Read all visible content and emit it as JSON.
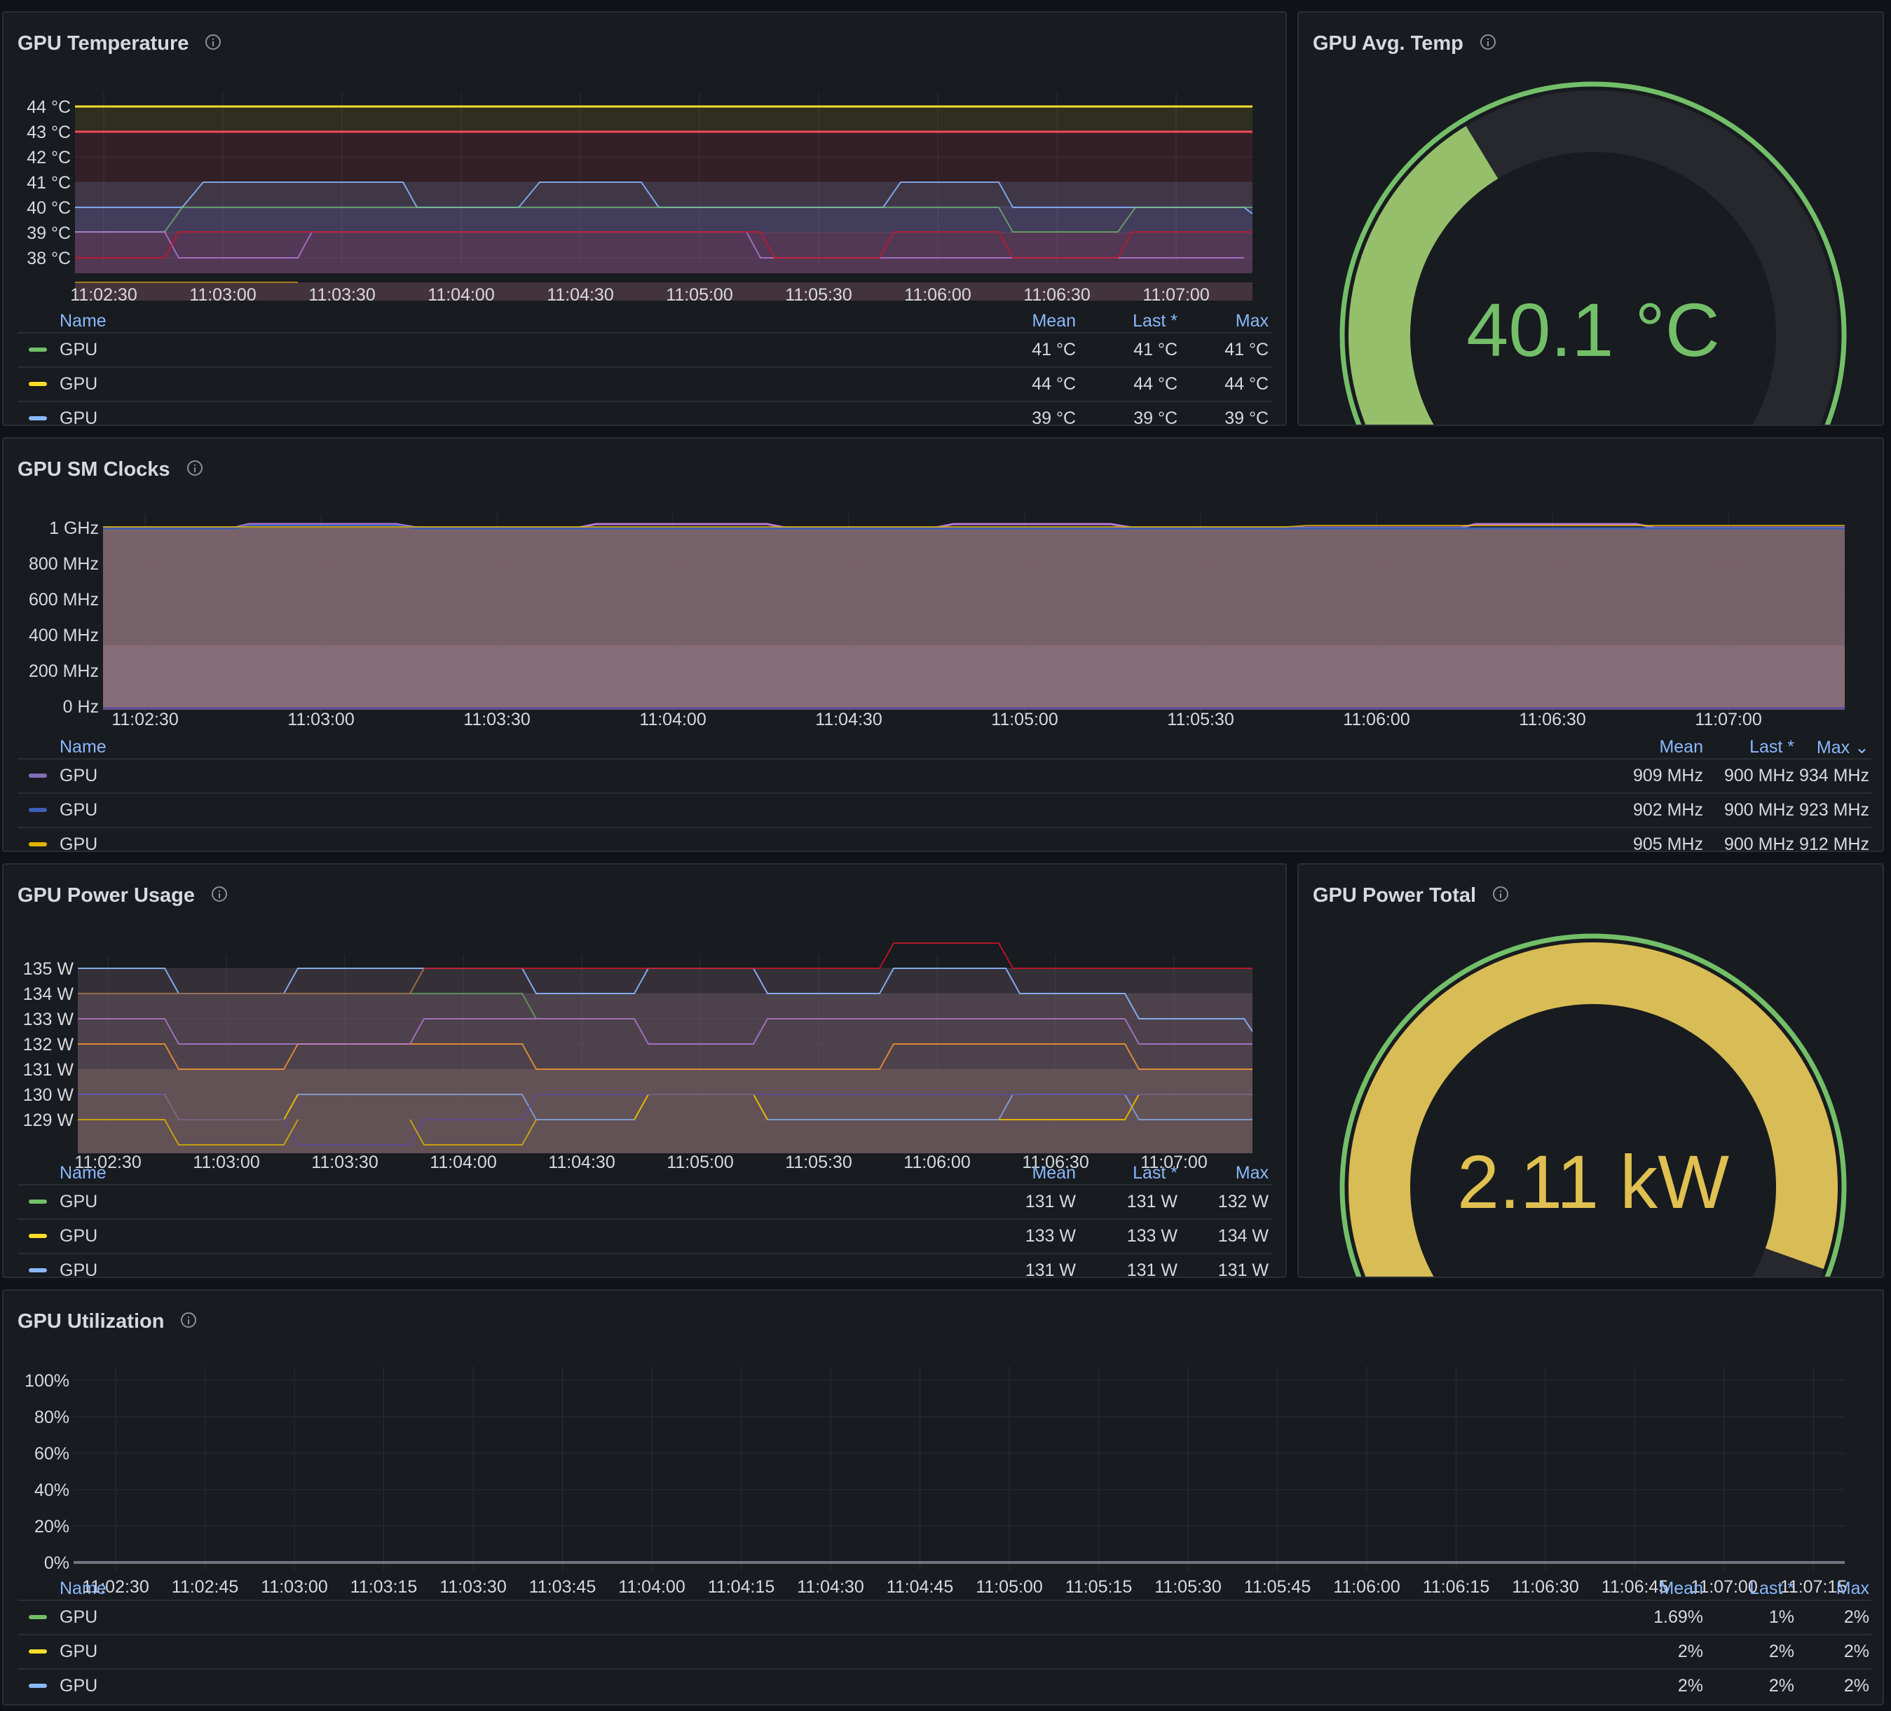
{
  "colors": {
    "green": "#73bf69",
    "yellow": "#fade2a",
    "blue": "#8ab8ff",
    "red": "#f2495c",
    "orange": "#ff9830",
    "purple": "#b877d9",
    "darkred": "#c4162a",
    "label_blue": "#8ab8ff"
  },
  "icons": {
    "info": "info-icon"
  },
  "temp": {
    "title": "GPU Temperature",
    "yticks": [
      "44 °C",
      "43 °C",
      "42 °C",
      "41 °C",
      "40 °C",
      "39 °C",
      "38 °C"
    ],
    "xticks": [
      "11:02:30",
      "11:03:00",
      "11:03:30",
      "11:04:00",
      "11:04:30",
      "11:05:00",
      "11:05:30",
      "11:06:00",
      "11:06:30",
      "11:07:00"
    ],
    "legend": {
      "headers": {
        "name": "Name",
        "mean": "Mean",
        "last": "Last *",
        "max": "Max"
      },
      "rows": [
        {
          "name": "GPU",
          "color": "#73bf69",
          "mean": "41 °C",
          "last": "41 °C",
          "max": "41 °C"
        },
        {
          "name": "GPU",
          "color": "#fade2a",
          "mean": "44 °C",
          "last": "44 °C",
          "max": "44 °C"
        },
        {
          "name": "GPU",
          "color": "#8ab8ff",
          "mean": "39 °C",
          "last": "39 °C",
          "max": "39 °C"
        }
      ]
    }
  },
  "avgtemp": {
    "title": "GPU Avg. Temp",
    "value": "40.1 °C",
    "fraction": 0.4
  },
  "clocks": {
    "title": "GPU SM Clocks",
    "yticks": [
      "1 GHz",
      "800 MHz",
      "600 MHz",
      "400 MHz",
      "200 MHz",
      "0 Hz"
    ],
    "xticks": [
      "11:02:30",
      "11:03:00",
      "11:03:30",
      "11:04:00",
      "11:04:30",
      "11:05:00",
      "11:05:30",
      "11:06:00",
      "11:06:30",
      "11:07:00"
    ],
    "legend": {
      "headers": {
        "name": "Name",
        "mean": "Mean",
        "last": "Last *",
        "max": "Max ⌄"
      },
      "rows": [
        {
          "name": "GPU",
          "color": "#806eb7",
          "mean": "909 MHz",
          "last": "900 MHz",
          "max": "934 MHz"
        },
        {
          "name": "GPU",
          "color": "#3d5eb5",
          "mean": "902 MHz",
          "last": "900 MHz",
          "max": "923 MHz"
        },
        {
          "name": "GPU",
          "color": "#e0b400",
          "mean": "905 MHz",
          "last": "900 MHz",
          "max": "912 MHz"
        }
      ]
    }
  },
  "power": {
    "title": "GPU Power Usage",
    "yticks": [
      "135 W",
      "134 W",
      "133 W",
      "132 W",
      "131 W",
      "130 W",
      "129 W"
    ],
    "xticks": [
      "11:02:30",
      "11:03:00",
      "11:03:30",
      "11:04:00",
      "11:04:30",
      "11:05:00",
      "11:05:30",
      "11:06:00",
      "11:06:30",
      "11:07:00"
    ],
    "legend": {
      "headers": {
        "name": "Name",
        "mean": "Mean",
        "last": "Last *",
        "max": "Max"
      },
      "rows": [
        {
          "name": "GPU",
          "color": "#73bf69",
          "mean": "131 W",
          "last": "131 W",
          "max": "132 W"
        },
        {
          "name": "GPU",
          "color": "#fade2a",
          "mean": "133 W",
          "last": "133 W",
          "max": "134 W"
        },
        {
          "name": "GPU",
          "color": "#8ab8ff",
          "mean": "131 W",
          "last": "131 W",
          "max": "131 W"
        }
      ]
    }
  },
  "powertotal": {
    "title": "GPU Power Total",
    "value": "2.11 kW",
    "fraction": 0.85
  },
  "util": {
    "title": "GPU Utilization",
    "yticks": [
      "100%",
      "80%",
      "60%",
      "40%",
      "20%",
      "0%"
    ],
    "xticks": [
      "11:02:30",
      "11:02:45",
      "11:03:00",
      "11:03:15",
      "11:03:30",
      "11:03:45",
      "11:04:00",
      "11:04:15",
      "11:04:30",
      "11:04:45",
      "11:05:00",
      "11:05:15",
      "11:05:30",
      "11:05:45",
      "11:06:00",
      "11:06:15",
      "11:06:30",
      "11:06:45",
      "11:07:00",
      "11:07:15"
    ],
    "legend": {
      "headers": {
        "name": "Name",
        "mean": "Mean",
        "last": "Last *",
        "max": "Max"
      },
      "rows": [
        {
          "name": "GPU",
          "color": "#73bf69",
          "mean": "1.69%",
          "last": "1%",
          "max": "2%"
        },
        {
          "name": "GPU",
          "color": "#fade2a",
          "mean": "2%",
          "last": "2%",
          "max": "2%"
        },
        {
          "name": "GPU",
          "color": "#8ab8ff",
          "mean": "2%",
          "last": "2%",
          "max": "2%"
        }
      ]
    }
  }
}
